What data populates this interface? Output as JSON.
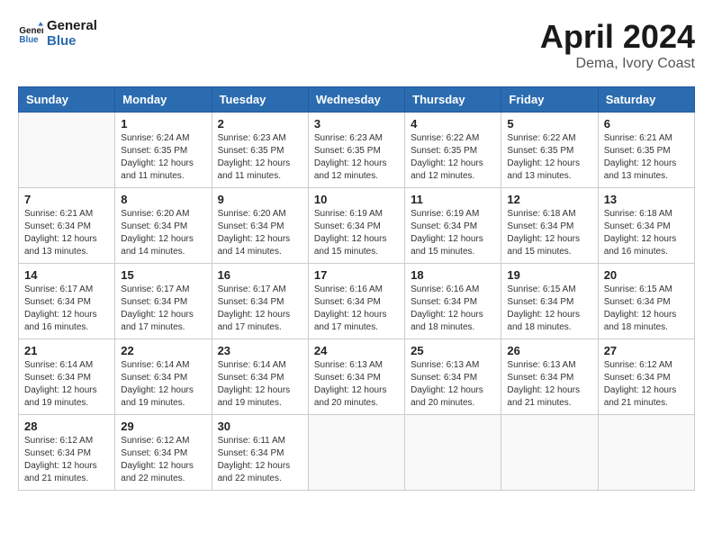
{
  "header": {
    "logo_line1": "General",
    "logo_line2": "Blue",
    "month": "April 2024",
    "location": "Dema, Ivory Coast"
  },
  "days_of_week": [
    "Sunday",
    "Monday",
    "Tuesday",
    "Wednesday",
    "Thursday",
    "Friday",
    "Saturday"
  ],
  "weeks": [
    [
      {
        "day": "",
        "sunrise": "",
        "sunset": "",
        "daylight": ""
      },
      {
        "day": "1",
        "sunrise": "Sunrise: 6:24 AM",
        "sunset": "Sunset: 6:35 PM",
        "daylight": "Daylight: 12 hours and 11 minutes."
      },
      {
        "day": "2",
        "sunrise": "Sunrise: 6:23 AM",
        "sunset": "Sunset: 6:35 PM",
        "daylight": "Daylight: 12 hours and 11 minutes."
      },
      {
        "day": "3",
        "sunrise": "Sunrise: 6:23 AM",
        "sunset": "Sunset: 6:35 PM",
        "daylight": "Daylight: 12 hours and 12 minutes."
      },
      {
        "day": "4",
        "sunrise": "Sunrise: 6:22 AM",
        "sunset": "Sunset: 6:35 PM",
        "daylight": "Daylight: 12 hours and 12 minutes."
      },
      {
        "day": "5",
        "sunrise": "Sunrise: 6:22 AM",
        "sunset": "Sunset: 6:35 PM",
        "daylight": "Daylight: 12 hours and 13 minutes."
      },
      {
        "day": "6",
        "sunrise": "Sunrise: 6:21 AM",
        "sunset": "Sunset: 6:35 PM",
        "daylight": "Daylight: 12 hours and 13 minutes."
      }
    ],
    [
      {
        "day": "7",
        "sunrise": "Sunrise: 6:21 AM",
        "sunset": "Sunset: 6:34 PM",
        "daylight": "Daylight: 12 hours and 13 minutes."
      },
      {
        "day": "8",
        "sunrise": "Sunrise: 6:20 AM",
        "sunset": "Sunset: 6:34 PM",
        "daylight": "Daylight: 12 hours and 14 minutes."
      },
      {
        "day": "9",
        "sunrise": "Sunrise: 6:20 AM",
        "sunset": "Sunset: 6:34 PM",
        "daylight": "Daylight: 12 hours and 14 minutes."
      },
      {
        "day": "10",
        "sunrise": "Sunrise: 6:19 AM",
        "sunset": "Sunset: 6:34 PM",
        "daylight": "Daylight: 12 hours and 15 minutes."
      },
      {
        "day": "11",
        "sunrise": "Sunrise: 6:19 AM",
        "sunset": "Sunset: 6:34 PM",
        "daylight": "Daylight: 12 hours and 15 minutes."
      },
      {
        "day": "12",
        "sunrise": "Sunrise: 6:18 AM",
        "sunset": "Sunset: 6:34 PM",
        "daylight": "Daylight: 12 hours and 15 minutes."
      },
      {
        "day": "13",
        "sunrise": "Sunrise: 6:18 AM",
        "sunset": "Sunset: 6:34 PM",
        "daylight": "Daylight: 12 hours and 16 minutes."
      }
    ],
    [
      {
        "day": "14",
        "sunrise": "Sunrise: 6:17 AM",
        "sunset": "Sunset: 6:34 PM",
        "daylight": "Daylight: 12 hours and 16 minutes."
      },
      {
        "day": "15",
        "sunrise": "Sunrise: 6:17 AM",
        "sunset": "Sunset: 6:34 PM",
        "daylight": "Daylight: 12 hours and 17 minutes."
      },
      {
        "day": "16",
        "sunrise": "Sunrise: 6:17 AM",
        "sunset": "Sunset: 6:34 PM",
        "daylight": "Daylight: 12 hours and 17 minutes."
      },
      {
        "day": "17",
        "sunrise": "Sunrise: 6:16 AM",
        "sunset": "Sunset: 6:34 PM",
        "daylight": "Daylight: 12 hours and 17 minutes."
      },
      {
        "day": "18",
        "sunrise": "Sunrise: 6:16 AM",
        "sunset": "Sunset: 6:34 PM",
        "daylight": "Daylight: 12 hours and 18 minutes."
      },
      {
        "day": "19",
        "sunrise": "Sunrise: 6:15 AM",
        "sunset": "Sunset: 6:34 PM",
        "daylight": "Daylight: 12 hours and 18 minutes."
      },
      {
        "day": "20",
        "sunrise": "Sunrise: 6:15 AM",
        "sunset": "Sunset: 6:34 PM",
        "daylight": "Daylight: 12 hours and 18 minutes."
      }
    ],
    [
      {
        "day": "21",
        "sunrise": "Sunrise: 6:14 AM",
        "sunset": "Sunset: 6:34 PM",
        "daylight": "Daylight: 12 hours and 19 minutes."
      },
      {
        "day": "22",
        "sunrise": "Sunrise: 6:14 AM",
        "sunset": "Sunset: 6:34 PM",
        "daylight": "Daylight: 12 hours and 19 minutes."
      },
      {
        "day": "23",
        "sunrise": "Sunrise: 6:14 AM",
        "sunset": "Sunset: 6:34 PM",
        "daylight": "Daylight: 12 hours and 19 minutes."
      },
      {
        "day": "24",
        "sunrise": "Sunrise: 6:13 AM",
        "sunset": "Sunset: 6:34 PM",
        "daylight": "Daylight: 12 hours and 20 minutes."
      },
      {
        "day": "25",
        "sunrise": "Sunrise: 6:13 AM",
        "sunset": "Sunset: 6:34 PM",
        "daylight": "Daylight: 12 hours and 20 minutes."
      },
      {
        "day": "26",
        "sunrise": "Sunrise: 6:13 AM",
        "sunset": "Sunset: 6:34 PM",
        "daylight": "Daylight: 12 hours and 21 minutes."
      },
      {
        "day": "27",
        "sunrise": "Sunrise: 6:12 AM",
        "sunset": "Sunset: 6:34 PM",
        "daylight": "Daylight: 12 hours and 21 minutes."
      }
    ],
    [
      {
        "day": "28",
        "sunrise": "Sunrise: 6:12 AM",
        "sunset": "Sunset: 6:34 PM",
        "daylight": "Daylight: 12 hours and 21 minutes."
      },
      {
        "day": "29",
        "sunrise": "Sunrise: 6:12 AM",
        "sunset": "Sunset: 6:34 PM",
        "daylight": "Daylight: 12 hours and 22 minutes."
      },
      {
        "day": "30",
        "sunrise": "Sunrise: 6:11 AM",
        "sunset": "Sunset: 6:34 PM",
        "daylight": "Daylight: 12 hours and 22 minutes."
      },
      {
        "day": "",
        "sunrise": "",
        "sunset": "",
        "daylight": ""
      },
      {
        "day": "",
        "sunrise": "",
        "sunset": "",
        "daylight": ""
      },
      {
        "day": "",
        "sunrise": "",
        "sunset": "",
        "daylight": ""
      },
      {
        "day": "",
        "sunrise": "",
        "sunset": "",
        "daylight": ""
      }
    ]
  ]
}
